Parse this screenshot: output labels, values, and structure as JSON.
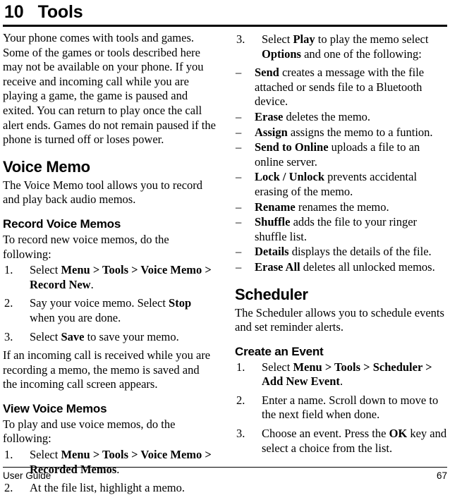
{
  "chapter": {
    "number": "10",
    "title": "Tools",
    "heading_display": "10   Tools"
  },
  "left_column": {
    "intro": "Your phone comes with tools and games. Some of the games or tools described here may not be available on your phone. If you receive and incoming call while you are playing a game, the game is paused and exited. You can return to play once the call alert ends. Games do not remain paused if the phone is turned off or loses power.",
    "voice_memo": {
      "heading": "Voice Memo",
      "intro": "The Voice Memo tool allows you to record and play back audio memos."
    },
    "record_voice_memos": {
      "heading": "Record Voice Memos",
      "intro": "To record new voice memos, do the following:",
      "steps": [
        {
          "num": "1.",
          "parts": [
            {
              "text": "Select ",
              "bold": false
            },
            {
              "text": "Menu > Tools > Voice Memo > Record New",
              "bold": true
            },
            {
              "text": ".",
              "bold": false
            }
          ]
        },
        {
          "num": "2.",
          "parts": [
            {
              "text": "Say your voice memo. Select ",
              "bold": false
            },
            {
              "text": "Stop",
              "bold": true
            },
            {
              "text": " when you are done.",
              "bold": false
            }
          ]
        },
        {
          "num": "3.",
          "parts": [
            {
              "text": "Select ",
              "bold": false
            },
            {
              "text": "Save",
              "bold": true
            },
            {
              "text": " to save your memo.",
              "bold": false
            }
          ]
        }
      ],
      "note": "If an incoming call is received while you are recording a memo, the memo is saved and the incoming call screen appears."
    },
    "view_voice_memos": {
      "heading": "View Voice Memos",
      "intro": "To play and use voice memos, do the following:",
      "steps": [
        {
          "num": "1.",
          "parts": [
            {
              "text": "Select ",
              "bold": false
            },
            {
              "text": "Menu > Tools > Voice Memo > Recorded Memos",
              "bold": true
            },
            {
              "text": ".",
              "bold": false
            }
          ]
        },
        {
          "num": "2.",
          "parts": [
            {
              "text": "At the file list, highlight a memo.",
              "bold": false
            }
          ]
        }
      ]
    }
  },
  "right_column": {
    "continued_steps": [
      {
        "num": "3.",
        "parts": [
          {
            "text": "Select ",
            "bold": false
          },
          {
            "text": "Play",
            "bold": true
          },
          {
            "text": " to play the memo select ",
            "bold": false
          },
          {
            "text": "Options",
            "bold": true
          },
          {
            "text": " and one of the following:",
            "bold": false
          }
        ]
      }
    ],
    "options": [
      {
        "dash": "–",
        "parts": [
          {
            "text": "Send",
            "bold": true
          },
          {
            "text": " creates a message with the file attached or sends file to a Bluetooth device.",
            "bold": false
          }
        ]
      },
      {
        "dash": "–",
        "parts": [
          {
            "text": "Erase",
            "bold": true
          },
          {
            "text": " deletes the memo.",
            "bold": false
          }
        ]
      },
      {
        "dash": "–",
        "parts": [
          {
            "text": "Assign",
            "bold": true
          },
          {
            "text": " assigns the memo to a funtion.",
            "bold": false
          }
        ]
      },
      {
        "dash": "–",
        "parts": [
          {
            "text": "Send to Online",
            "bold": true
          },
          {
            "text": " uploads a file to an online server.",
            "bold": false
          }
        ]
      },
      {
        "dash": "–",
        "parts": [
          {
            "text": "Lock / Unlock",
            "bold": true
          },
          {
            "text": " prevents accidental erasing of the memo.",
            "bold": false
          }
        ]
      },
      {
        "dash": "–",
        "parts": [
          {
            "text": "Rename",
            "bold": true
          },
          {
            "text": " renames the memo.",
            "bold": false
          }
        ]
      },
      {
        "dash": "–",
        "parts": [
          {
            "text": "Shuffle",
            "bold": true
          },
          {
            "text": " adds the file to your ringer shuffle list.",
            "bold": false
          }
        ]
      },
      {
        "dash": "–",
        "parts": [
          {
            "text": "Details",
            "bold": true
          },
          {
            "text": " displays the details of the file.",
            "bold": false
          }
        ]
      },
      {
        "dash": "–",
        "parts": [
          {
            "text": "Erase All",
            "bold": true
          },
          {
            "text": " deletes all unlocked memos.",
            "bold": false
          }
        ]
      }
    ],
    "scheduler": {
      "heading": "Scheduler",
      "intro": "The Scheduler allows you to schedule events and set reminder alerts."
    },
    "create_an_event": {
      "heading": "Create an Event",
      "steps": [
        {
          "num": "1.",
          "parts": [
            {
              "text": "Select ",
              "bold": false
            },
            {
              "text": "Menu > Tools > Scheduler > Add New Event",
              "bold": true
            },
            {
              "text": ".",
              "bold": false
            }
          ]
        },
        {
          "num": "2.",
          "parts": [
            {
              "text": "Enter a name. Scroll down to move to the next field when done.",
              "bold": false
            }
          ]
        },
        {
          "num": "3.",
          "parts": [
            {
              "text": "Choose an event. Press the ",
              "bold": false
            },
            {
              "text": "OK",
              "bold": true
            },
            {
              "text": " key and select a choice from the list.",
              "bold": false
            }
          ]
        }
      ]
    }
  },
  "footer": {
    "left": "User Guide",
    "page_number": "67"
  }
}
